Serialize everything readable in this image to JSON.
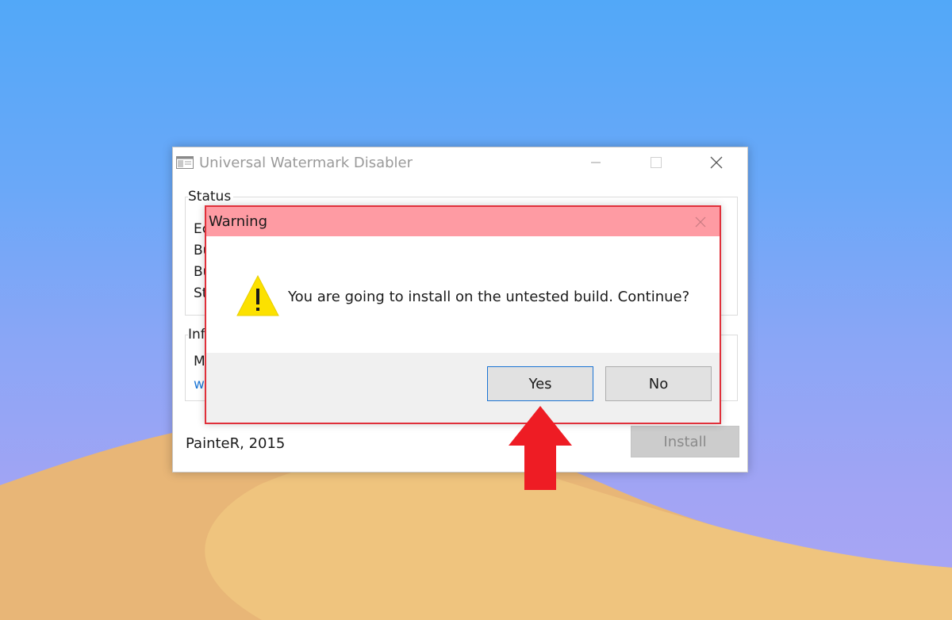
{
  "main_window": {
    "title": "Universal Watermark Disabler",
    "status_group_label": "Status",
    "info_group_label": "Inf",
    "status_rows_partial": [
      "Ec",
      "Bu",
      "Bu",
      "St"
    ],
    "info_rows_partial": [
      "M",
      "w"
    ],
    "footer_credit": "PainteR, 2015",
    "install_label": "Install",
    "install_enabled": false
  },
  "warning_dialog": {
    "title": "Warning",
    "message": "You are going to install on the untested build. Continue?",
    "icon": "warning-triangle-icon",
    "yes_label": "Yes",
    "no_label": "No",
    "default_button": "Yes"
  },
  "colors": {
    "dialog_title_bg": "#fe9ba3",
    "dialog_border": "#e0303a",
    "arrow": "#ee1c24",
    "focus_border": "#1b74d4",
    "link": "#1e78d6",
    "warning_yellow": "#fce100"
  }
}
